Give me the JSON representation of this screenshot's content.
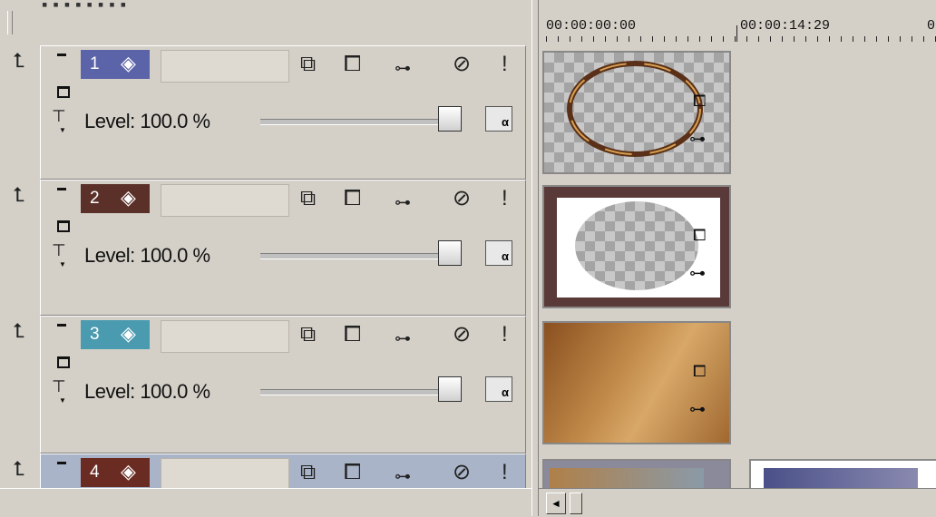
{
  "ruler": {
    "time_start": "00:00:00:00",
    "time_mid": "00:00:14:29",
    "time_end_partial": "0"
  },
  "tracks": [
    {
      "number": "1",
      "color": "#5b64a8",
      "level_text": "Level: 100.0 %",
      "level_percent": 100
    },
    {
      "number": "2",
      "color": "#5a3028",
      "level_text": "Level: 100.0 %",
      "level_percent": 100
    },
    {
      "number": "3",
      "color": "#4a9ab0",
      "level_text": "Level: 100.0 %",
      "level_percent": 100
    },
    {
      "number": "4",
      "color": "#6a2c22"
    }
  ],
  "icons": {
    "track_toolbar": [
      "mask-icon",
      "compositor-icon",
      "pan-crop-icon",
      "mute-icon",
      "solo-icon"
    ],
    "alpha_label": "α",
    "scroll_left": "◄"
  }
}
